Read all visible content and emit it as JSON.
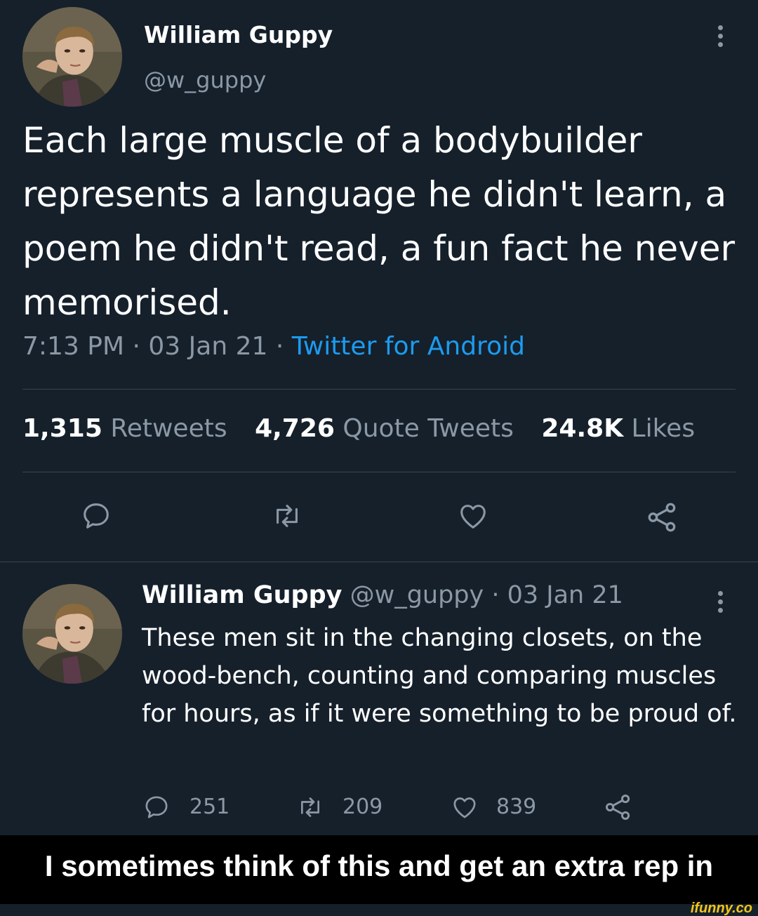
{
  "tweet": {
    "name": "William Guppy",
    "handle": "@w_guppy",
    "text": "Each large muscle of a bodybuilder represents a language he didn't learn, a poem he didn't read, a fun fact he never memorised.",
    "time": "7:13 PM · 03 Jan 21 · ",
    "source": "Twitter for Android",
    "stats": {
      "retweets_count": "1,315",
      "retweets_label": "Retweets",
      "quotes_count": "4,726",
      "quotes_label": "Quote Tweets",
      "likes_count": "24.8K",
      "likes_label": "Likes"
    },
    "icons": [
      "reply-icon",
      "retweet-icon",
      "like-icon",
      "share-icon",
      "more-icon"
    ]
  },
  "reply": {
    "name": "William Guppy",
    "meta": " @w_guppy · 03 Jan 21",
    "text": "These men sit in the changing closets, on the wood-bench, counting and comparing muscles for hours, as if it were something to be proud of.",
    "replies": "251",
    "retweets": "209",
    "likes": "839"
  },
  "caption": "I sometimes think of this and get an extra rep in",
  "watermark": "ifunny.co",
  "colors": {
    "background": "#15202b",
    "secondary_text": "#8b98a5",
    "link": "#1d9bf0",
    "divider": "#38444d",
    "caption_bar": "#000000",
    "watermark": "#f5c518"
  }
}
